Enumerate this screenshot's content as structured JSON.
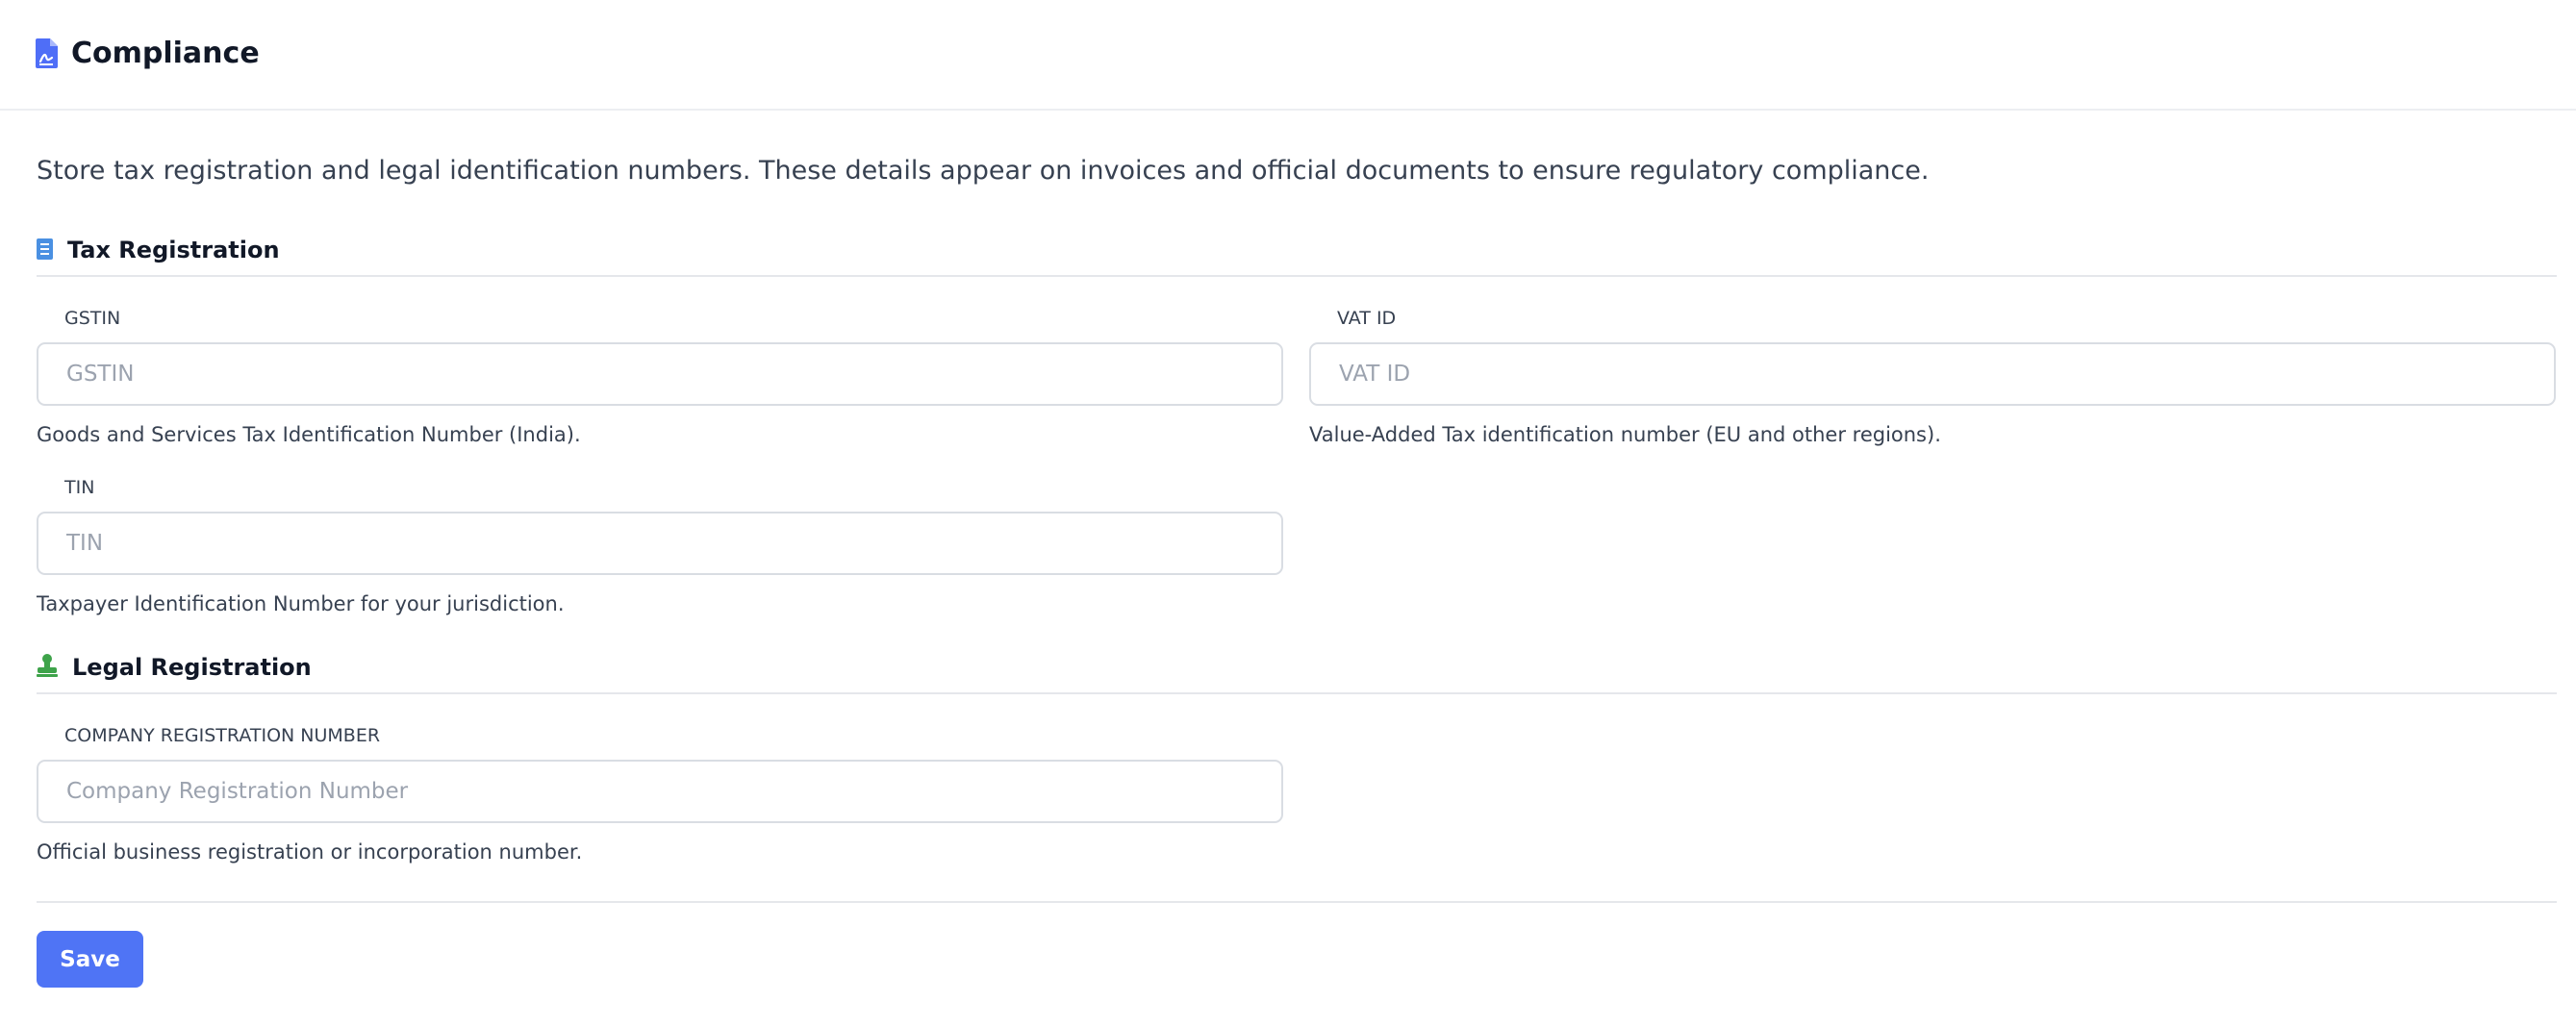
{
  "header": {
    "title": "Compliance",
    "icon": "document-certificate-icon",
    "icon_color": "#4f6ef7"
  },
  "intro_text": "Store tax registration and legal identification numbers. These details appear on invoices and official documents to ensure regulatory compliance.",
  "sections": {
    "tax": {
      "title": "Tax Registration",
      "icon": "receipt-icon",
      "icon_color": "#4a90e2",
      "fields": {
        "gstin": {
          "label": "GSTIN",
          "value": "",
          "placeholder": "GSTIN",
          "help": "Goods and Services Tax Identification Number (India)."
        },
        "vat": {
          "label": "VAT ID",
          "value": "",
          "placeholder": "VAT ID",
          "help": "Value-Added Tax identification number (EU and other regions)."
        },
        "tin": {
          "label": "TIN",
          "value": "",
          "placeholder": "TIN",
          "help": "Taxpayer Identification Number for your jurisdiction."
        }
      }
    },
    "legal": {
      "title": "Legal Registration",
      "icon": "stamp-icon",
      "icon_color": "#3ea34a",
      "fields": {
        "company_reg": {
          "label": "COMPANY REGISTRATION NUMBER",
          "value": "",
          "placeholder": "Company Registration Number",
          "help": "Official business registration or incorporation number."
        }
      }
    }
  },
  "actions": {
    "save_label": "Save",
    "accent_color": "#4f74f5"
  }
}
